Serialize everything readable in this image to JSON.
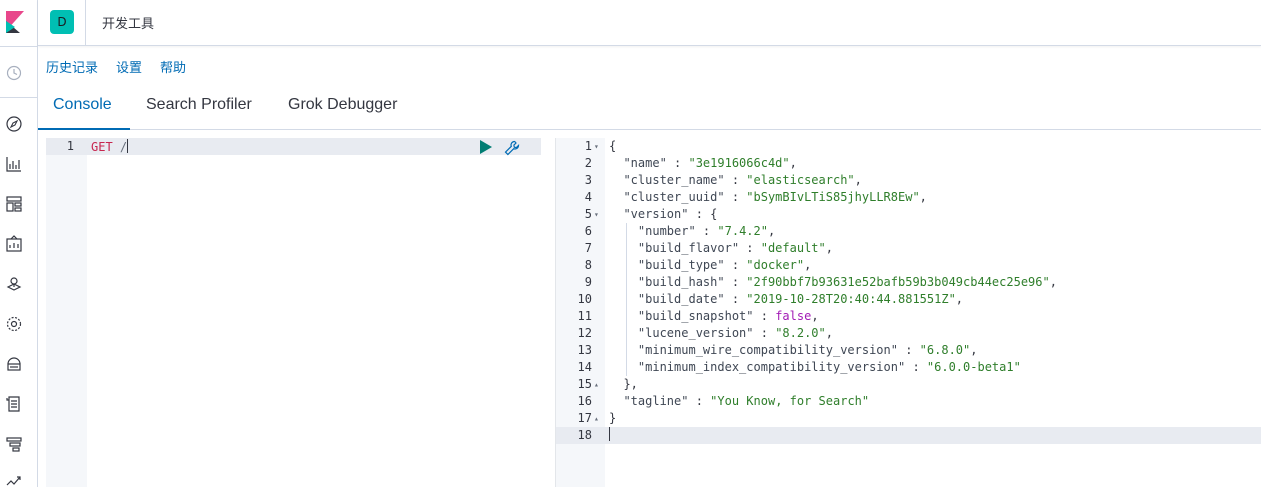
{
  "header": {
    "space_initial": "D",
    "breadcrumb": "开发工具"
  },
  "menu": {
    "history": "历史记录",
    "settings": "设置",
    "help": "帮助"
  },
  "tabs": [
    {
      "label": "Console",
      "selected": true
    },
    {
      "label": "Search Profiler",
      "selected": false
    },
    {
      "label": "Grok Debugger",
      "selected": false
    }
  ],
  "request": {
    "line_number": "1",
    "method": "GET",
    "path": "/"
  },
  "response": {
    "lines": [
      {
        "n": "1",
        "fold": "▾",
        "text": "{"
      },
      {
        "n": "2",
        "fold": "",
        "key": "\"name\"",
        "value": "\"3e1916066c4d\"",
        "vtype": "s",
        "indent": 1,
        "comma": true
      },
      {
        "n": "3",
        "fold": "",
        "key": "\"cluster_name\"",
        "value": "\"elasticsearch\"",
        "vtype": "s",
        "indent": 1,
        "comma": true
      },
      {
        "n": "4",
        "fold": "",
        "key": "\"cluster_uuid\"",
        "value": "\"bSymBIvLTiS85jhyLLR8Ew\"",
        "vtype": "s",
        "indent": 1,
        "comma": true
      },
      {
        "n": "5",
        "fold": "▾",
        "key": "\"version\"",
        "value": "{",
        "vtype": "p",
        "indent": 1,
        "comma": false
      },
      {
        "n": "6",
        "fold": "",
        "key": "\"number\"",
        "value": "\"7.4.2\"",
        "vtype": "s",
        "indent": 2,
        "comma": true
      },
      {
        "n": "7",
        "fold": "",
        "key": "\"build_flavor\"",
        "value": "\"default\"",
        "vtype": "s",
        "indent": 2,
        "comma": true
      },
      {
        "n": "8",
        "fold": "",
        "key": "\"build_type\"",
        "value": "\"docker\"",
        "vtype": "s",
        "indent": 2,
        "comma": true
      },
      {
        "n": "9",
        "fold": "",
        "key": "\"build_hash\"",
        "value": "\"2f90bbf7b93631e52bafb59b3b049cb44ec25e96\"",
        "vtype": "s",
        "indent": 2,
        "comma": true
      },
      {
        "n": "10",
        "fold": "",
        "key": "\"build_date\"",
        "value": "\"2019-10-28T20:40:44.881551Z\"",
        "vtype": "s",
        "indent": 2,
        "comma": true
      },
      {
        "n": "11",
        "fold": "",
        "key": "\"build_snapshot\"",
        "value": "false",
        "vtype": "b",
        "indent": 2,
        "comma": true
      },
      {
        "n": "12",
        "fold": "",
        "key": "\"lucene_version\"",
        "value": "\"8.2.0\"",
        "vtype": "s",
        "indent": 2,
        "comma": true
      },
      {
        "n": "13",
        "fold": "",
        "key": "\"minimum_wire_compatibility_version\"",
        "value": "\"6.8.0\"",
        "vtype": "s",
        "indent": 2,
        "comma": true
      },
      {
        "n": "14",
        "fold": "",
        "key": "\"minimum_index_compatibility_version\"",
        "value": "\"6.0.0-beta1\"",
        "vtype": "s",
        "indent": 2,
        "comma": false
      },
      {
        "n": "15",
        "fold": "▴",
        "text": "  },"
      },
      {
        "n": "16",
        "fold": "",
        "key": "\"tagline\"",
        "value": "\"You Know, for Search\"",
        "vtype": "s",
        "indent": 1,
        "comma": false
      },
      {
        "n": "17",
        "fold": "▴",
        "text": "}"
      },
      {
        "n": "18",
        "fold": "",
        "text": "",
        "cursor": true
      }
    ]
  },
  "colors": {
    "accent": "#006bb4",
    "space_badge": "#00bfb3",
    "json_string": "#2f7e2b",
    "json_boolean": "#a21bb5",
    "run_button": "#017d73"
  }
}
